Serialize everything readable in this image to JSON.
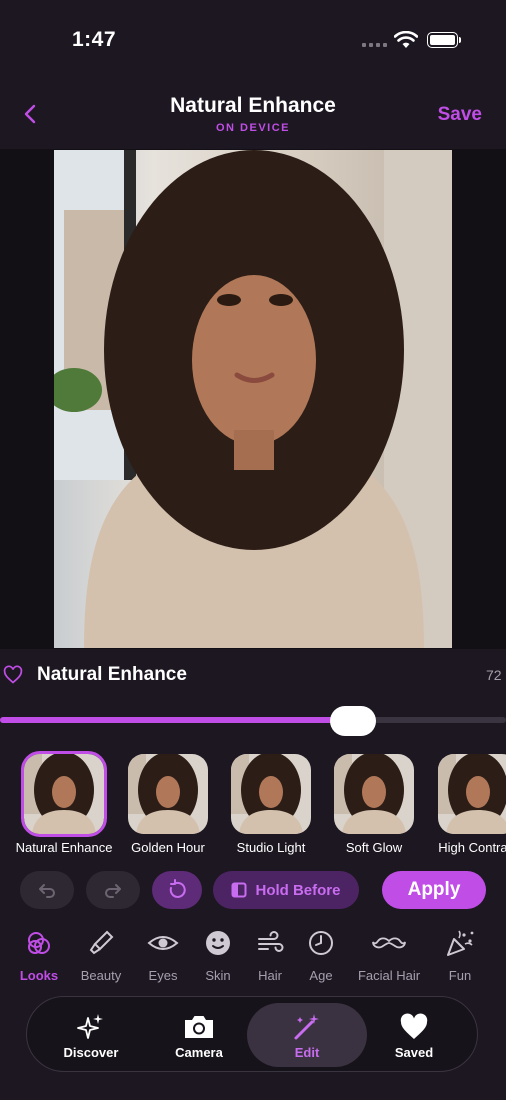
{
  "status_bar": {
    "time": "1:47"
  },
  "header": {
    "title": "Natural Enhance",
    "subtitle": "ON DEVICE",
    "save_label": "Save",
    "back_icon": "chevron-left-icon"
  },
  "look": {
    "name": "Natural Enhance",
    "value": "72",
    "intensity": 0.72
  },
  "presets": [
    {
      "label": "Natural Enhance",
      "selected": true
    },
    {
      "label": "Golden Hour",
      "selected": false
    },
    {
      "label": "Studio Light",
      "selected": false
    },
    {
      "label": "Soft Glow",
      "selected": false
    },
    {
      "label": "High Contrast",
      "selected": false
    }
  ],
  "actions": {
    "hold_before_label": "Hold Before",
    "apply_label": "Apply"
  },
  "categories": [
    {
      "label": "Looks",
      "icon": "looks-icon",
      "active": true
    },
    {
      "label": "Beauty",
      "icon": "brush-icon",
      "active": false
    },
    {
      "label": "Eyes",
      "icon": "eye-icon",
      "active": false
    },
    {
      "label": "Skin",
      "icon": "smile-icon",
      "active": false
    },
    {
      "label": "Hair",
      "icon": "wind-icon",
      "active": false
    },
    {
      "label": "Age",
      "icon": "clock-icon",
      "active": false
    },
    {
      "label": "Facial Hair",
      "icon": "mustache-icon",
      "active": false
    },
    {
      "label": "Fun",
      "icon": "party-popper-icon",
      "active": false
    }
  ],
  "tabs": [
    {
      "label": "Discover",
      "icon": "sparkles-icon",
      "active": false
    },
    {
      "label": "Camera",
      "icon": "camera-icon",
      "active": false
    },
    {
      "label": "Edit",
      "icon": "magic-wand-icon",
      "active": true
    },
    {
      "label": "Saved",
      "icon": "heart-icon",
      "active": false
    }
  ],
  "colors": {
    "accent": "#c04ee6",
    "background": "#1d1722"
  }
}
